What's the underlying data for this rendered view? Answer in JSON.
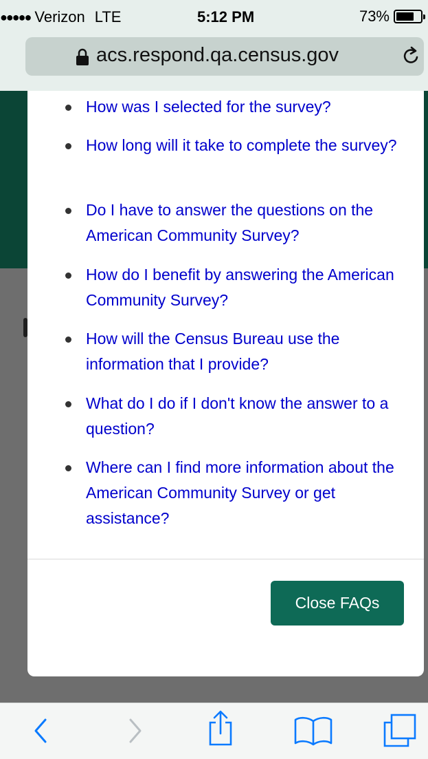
{
  "status_bar": {
    "signal_dots": "●●●●●",
    "carrier": "Verizon",
    "network": "LTE",
    "time": "5:12 PM",
    "battery_percent": "73%",
    "battery_level": 0.73
  },
  "browser": {
    "url": "acs.respond.qa.census.gov",
    "lock_icon": "lock-icon",
    "reload_icon": "reload-icon"
  },
  "faq_modal": {
    "items": [
      {
        "label": "How was I selected for the survey?"
      },
      {
        "label": "How long will it take to complete the survey?"
      },
      {
        "label": "Do I have to answer the questions on the American Community Survey?"
      },
      {
        "label": "How do I benefit by answering the American Community Survey?"
      },
      {
        "label": "How will the Census Bureau use the information that I provide?"
      },
      {
        "label": "What do I do if I don't know the answer to a question?"
      },
      {
        "label": "Where can I find more information about the American Community Survey or get assistance?"
      }
    ],
    "close_label": "Close FAQs"
  },
  "toolbar": {
    "icons": [
      "back-icon",
      "forward-icon",
      "share-icon",
      "bookmarks-icon",
      "tabs-icon"
    ]
  },
  "colors": {
    "link": "#0000cc",
    "button": "#0e6a56",
    "page_header": "#0b4536"
  }
}
